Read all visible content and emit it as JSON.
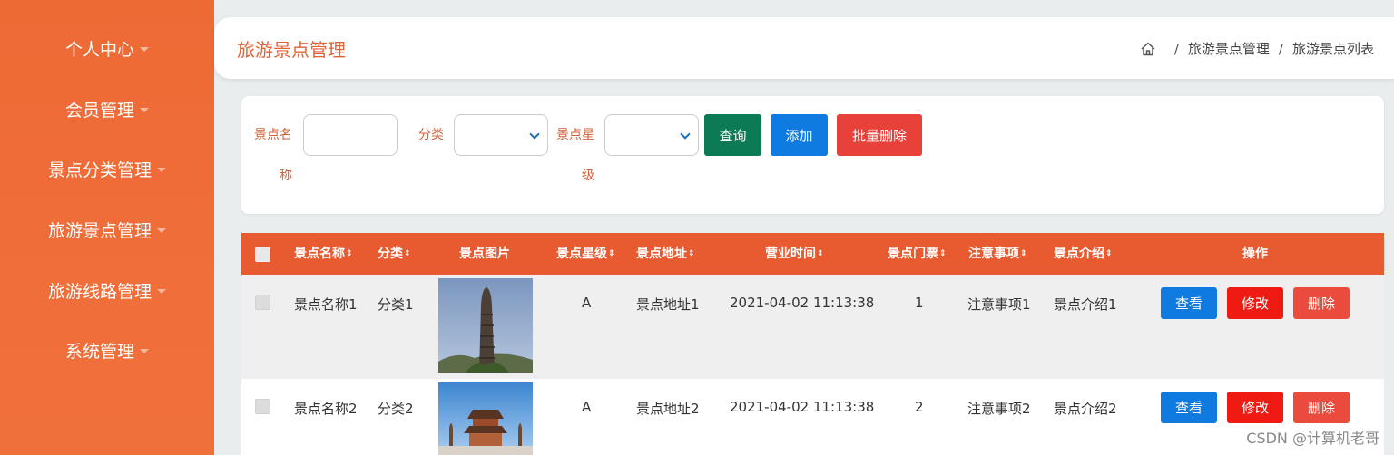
{
  "sidebar": {
    "items": [
      {
        "label": "个人中心"
      },
      {
        "label": "会员管理"
      },
      {
        "label": "景点分类管理"
      },
      {
        "label": "旅游景点管理"
      },
      {
        "label": "旅游线路管理"
      },
      {
        "label": "系统管理"
      }
    ]
  },
  "header": {
    "title": "旅游景点管理",
    "breadcrumb": [
      "旅游景点管理",
      "旅游景点列表"
    ]
  },
  "search": {
    "name_label_line1": "景点名",
    "name_label_line2": "称",
    "name_value": "",
    "category_label": "分类",
    "category_value": "",
    "star_label_line1": "景点星",
    "star_label_line2": "级",
    "star_value": "",
    "query_button": "查询",
    "add_button": "添加",
    "batch_delete_button": "批量删除"
  },
  "table": {
    "headers": [
      "景点名称",
      "分类",
      "景点图片",
      "景点星级",
      "景点地址",
      "营业时间",
      "景点门票",
      "注意事项",
      "景点介绍",
      "操作"
    ],
    "rows": [
      {
        "name": "景点名称1",
        "category": "分类1",
        "star": "A",
        "address": "景点地址1",
        "hours": "2021-04-02 11:13:38",
        "ticket": "1",
        "notes": "注意事项1",
        "intro": "景点介绍1"
      },
      {
        "name": "景点名称2",
        "category": "分类2",
        "star": "A",
        "address": "景点地址2",
        "hours": "2021-04-02 11:13:38",
        "ticket": "2",
        "notes": "注意事项2",
        "intro": "景点介绍2"
      }
    ],
    "actions": {
      "view": "查看",
      "edit": "修改",
      "delete": "删除"
    }
  },
  "watermark": "CSDN @计算机老哥",
  "colors": {
    "sidebar": "#ee6a35",
    "table_header": "#e85a30",
    "query_button": "#0b7a55",
    "add_button": "#0f7be0",
    "batch_delete_button": "#e8413a",
    "view_button": "#0f7be0",
    "edit_button": "#ef1a12",
    "delete_button": "#ea4b3c"
  }
}
